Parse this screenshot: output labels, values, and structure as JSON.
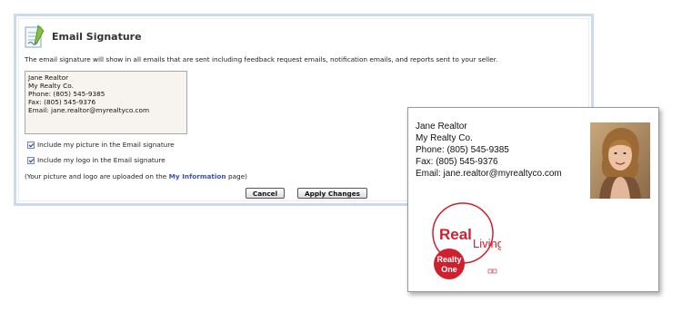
{
  "panel": {
    "title": "Email Signature",
    "description": "The email signature will show in all emails that are sent including feedback request emails, notification emails, and reports sent to your seller.",
    "signature_lines": [
      "Jane Realtor",
      "My Realty Co.",
      "Phone: (805) 545-9385",
      "Fax: (805) 545-9376",
      "Email: jane.realtor@myrealtyco.com"
    ],
    "include_picture_label": "Include my picture in the Email signature",
    "include_picture_checked": true,
    "include_logo_label": "Include my logo in the Email signature",
    "include_logo_checked": true,
    "note_prefix": "(Your picture and logo are uploaded on the",
    "note_link": "My Information",
    "note_suffix": "page)",
    "cancel_label": "Cancel",
    "apply_label": "Apply Changes"
  },
  "preview": {
    "lines": [
      "Jane Realtor",
      "My Realty Co.",
      "Phone: (805) 545-9385",
      "Fax: (805) 545-9376",
      "Email: jane.realtor@myrealtyco.com"
    ],
    "logo": {
      "word_1": "Real",
      "word_2": "Living",
      "word_3": "Realty",
      "word_4": "One"
    }
  },
  "colors": {
    "panel_border": "#cdd9f4",
    "link": "#3355bb",
    "logo_red": "#d0202e"
  }
}
